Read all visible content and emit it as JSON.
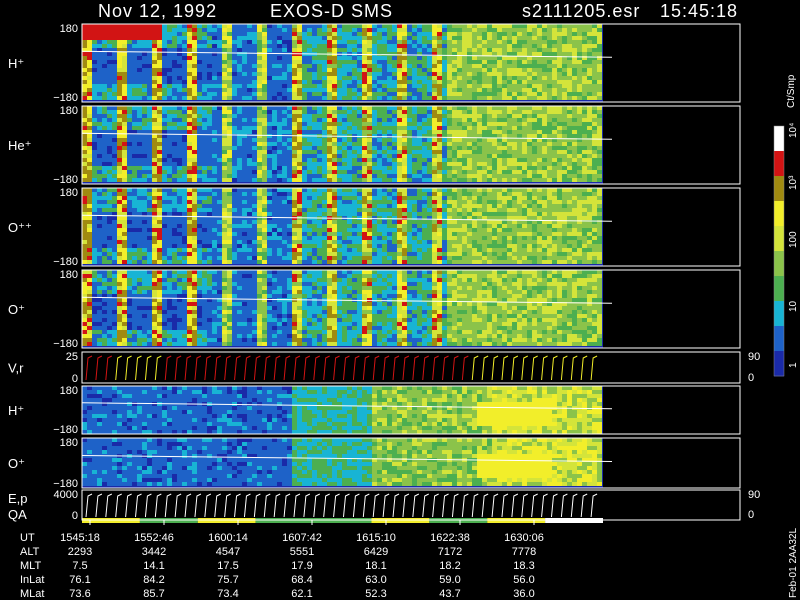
{
  "header": {
    "date": "Nov 12, 1992",
    "instrument": "EXOS-D SMS",
    "file": "s2111205.esr",
    "time": "15:45:18"
  },
  "colorbar": {
    "unit": "Ct/Smp",
    "tick_labels": [
      "1",
      "10",
      "100",
      "10³",
      "10⁴"
    ],
    "colors": [
      "#1a2aa8",
      "#1e62c8",
      "#18b4d4",
      "#4caf50",
      "#8bc34a",
      "#d4e43a",
      "#f2ee2a",
      "#a08a10",
      "#d21414",
      "#ffffff"
    ]
  },
  "annotation": "Feb-01 2AA32L",
  "chart_data": {
    "type": "heatmap",
    "time_labels": [
      "1545:18",
      "1552:46",
      "1600:14",
      "1607:42",
      "1615:10",
      "1622:38",
      "1630:06"
    ],
    "panels": [
      {
        "label": "H⁺",
        "ytop": "180",
        "ybot": "−180",
        "type": "pitch-angle spectrogram"
      },
      {
        "label": "He⁺",
        "ytop": "180",
        "ybot": "−180",
        "type": "pitch-angle spectrogram"
      },
      {
        "label": "O⁺⁺",
        "ytop": "180",
        "ybot": "−180",
        "type": "pitch-angle spectrogram"
      },
      {
        "label": "O⁺",
        "ytop": "180",
        "ybot": "−180",
        "type": "pitch-angle spectrogram"
      },
      {
        "label": "V,r",
        "ytop": "25",
        "ybot": "0",
        "right_top": "90",
        "right_bot": "0",
        "type": "line sweeps"
      },
      {
        "label": "H⁺",
        "ytop": "180",
        "ybot": "−180",
        "type": "spectrogram"
      },
      {
        "label": "O⁺",
        "ytop": "180",
        "ybot": "−180",
        "type": "spectrogram"
      },
      {
        "label": "E,p",
        "label2": "QA",
        "ytop": "4000",
        "ybot": "0",
        "right_top": "90",
        "right_bot": "0",
        "type": "line sweeps"
      }
    ],
    "ephemeris": {
      "rows": [
        {
          "name": "UT",
          "values": [
            "1545:18",
            "1552:46",
            "1600:14",
            "1607:42",
            "1615:10",
            "1622:38",
            "1630:06"
          ]
        },
        {
          "name": "ALT",
          "values": [
            "2293",
            "3442",
            "4547",
            "5551",
            "6429",
            "7172",
            "7778"
          ]
        },
        {
          "name": "MLT",
          "values": [
            "7.5",
            "14.1",
            "17.5",
            "17.9",
            "18.1",
            "18.2",
            "18.3"
          ]
        },
        {
          "name": "InLat",
          "values": [
            "76.1",
            "84.2",
            "75.7",
            "68.4",
            "63.0",
            "59.0",
            "56.0"
          ]
        },
        {
          "name": "MLat",
          "values": [
            "73.6",
            "85.7",
            "73.4",
            "62.1",
            "52.3",
            "43.7",
            "36.0"
          ]
        }
      ]
    },
    "qa_bar": [
      "yellow",
      "green",
      "yellow",
      "green",
      "green",
      "yellow",
      "green",
      "yellow",
      "white"
    ]
  }
}
